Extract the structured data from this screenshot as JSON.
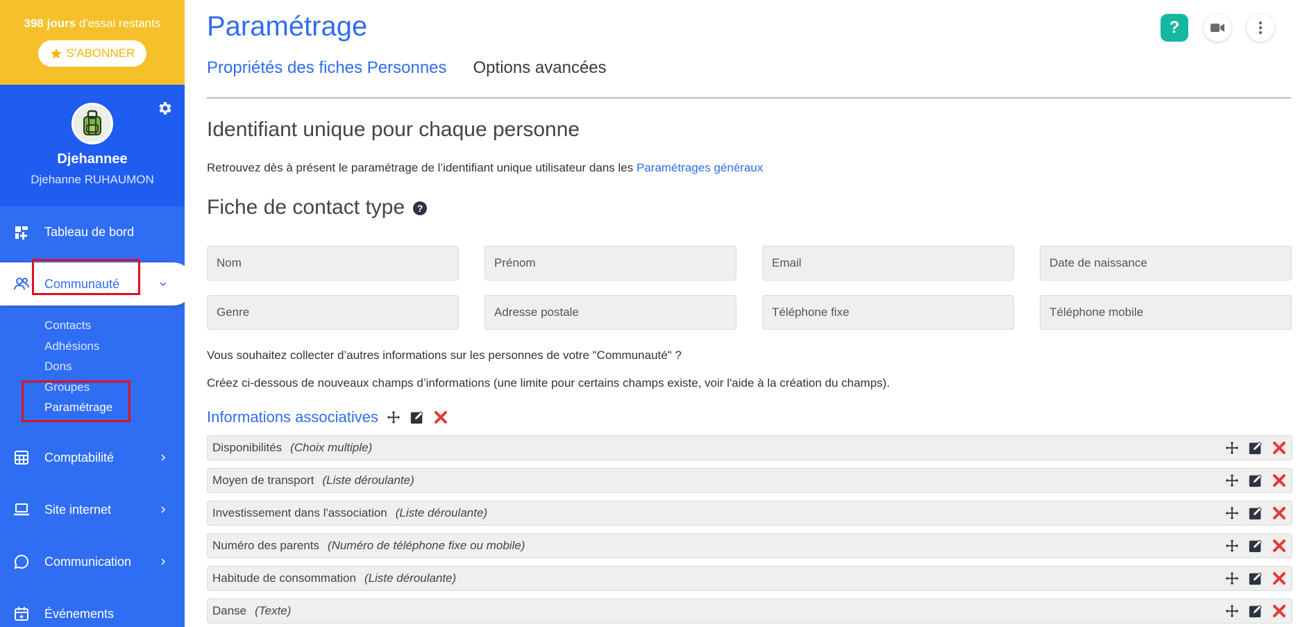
{
  "trial": {
    "days": "398 jours",
    "suffix": " d'essai restants",
    "subscribe_label": "S'ABONNER"
  },
  "profile": {
    "username": "Djehannee",
    "fullname": "Djehanne RUHAUMON"
  },
  "nav": {
    "dashboard": "Tableau de bord",
    "community": "Communauté",
    "community_sub": [
      "Contacts",
      "Adhésions",
      "Dons",
      "Groupes",
      "Paramétrage"
    ],
    "accounting": "Comptabilité",
    "website": "Site internet",
    "communication": "Communication",
    "events": "Événements"
  },
  "header": {
    "title": "Paramétrage",
    "help": "?"
  },
  "tabs": [
    "Propriétés des fiches Personnes",
    "Options avancées"
  ],
  "unique_id": {
    "title": "Identifiant unique pour chaque personne",
    "text": "Retrouvez dès à présent le paramétrage de l’identifiant unique utilisateur dans les ",
    "link": "Paramétrages généraux"
  },
  "contact_card": {
    "title": "Fiche de contact type",
    "help": "?",
    "fields": [
      "Nom",
      "Prénom",
      "Email",
      "Date de naissance",
      "Genre",
      "Adresse postale",
      "Téléphone fixe",
      "Téléphone mobile"
    ],
    "note1": "Vous souhaitez collecter d’autres informations sur les personnes de votre \"Communauté\" ?",
    "note2": "Créez ci-dessous de nouveaux champs d’informations (une limite pour certains champs existe, voir l'aide à la création du champs)."
  },
  "group": {
    "title": "Informations associatives",
    "rows": [
      {
        "name": "Disponibilités",
        "type": "(Choix multiple)"
      },
      {
        "name": "Moyen de transport",
        "type": "(Liste déroulante)"
      },
      {
        "name": "Investissement dans l'association",
        "type": "(Liste déroulante)"
      },
      {
        "name": "Numéro des parents",
        "type": "(Numéro de téléphone fixe ou mobile)"
      },
      {
        "name": "Habitude de consommation",
        "type": "(Liste déroulante)"
      },
      {
        "name": "Danse",
        "type": "(Texte)"
      }
    ]
  },
  "colors": {
    "primary": "#2f6df2",
    "trial": "#f6c02b",
    "help": "#14b8a1",
    "danger": "#e53935",
    "highlight": "#e0101e"
  },
  "icons": [
    "star-icon",
    "gear-icon",
    "dashboard-icon",
    "community-icon",
    "accounting-icon",
    "laptop-icon",
    "chat-icon",
    "calendar-icon",
    "video-icon",
    "more-vertical-icon",
    "move-icon",
    "edit-icon",
    "delete-icon",
    "chevron-down-icon",
    "chevron-right-icon"
  ]
}
